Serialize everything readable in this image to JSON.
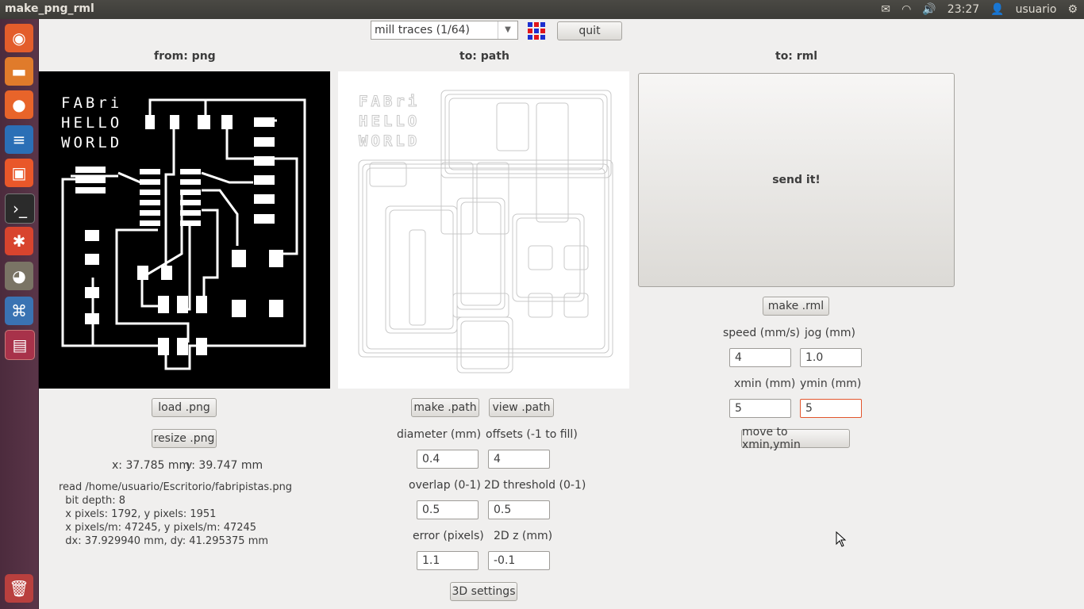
{
  "window": {
    "title": "make_png_rml"
  },
  "tray": {
    "time": "23:27",
    "user": "usuario"
  },
  "toolbar": {
    "mode_select": "mill traces (1/64)",
    "quit_label": "quit"
  },
  "columns": {
    "from_png": "from: png",
    "to_path": "to: path",
    "to_rml": "to: rml"
  },
  "board_text": {
    "line1": "FABri",
    "line2": "HELLO",
    "line3": "WORLD"
  },
  "png_panel": {
    "load_label": "load .png",
    "resize_label": "resize .png",
    "size_readout_x": "x: 37.785 mm",
    "size_readout_y": "y: 39.747 mm",
    "info": "read /home/usuario/Escritorio/fabripistas.png\n  bit depth: 8\n  x pixels: 1792, y pixels: 1951\n  x pixels/m: 47245, y pixels/m: 47245\n  dx: 37.929940 mm, dy: 41.295375 mm"
  },
  "path_panel": {
    "make_path_label": "make .path",
    "view_path_label": "view .path",
    "diameter_label": "diameter (mm)",
    "offsets_label": "offsets (-1 to fill)",
    "diameter_value": "0.4",
    "offsets_value": "4",
    "overlap_label": "overlap (0-1)",
    "threshold_label": "2D threshold (0-1)",
    "overlap_value": "0.5",
    "threshold_value": "0.5",
    "error_label": "error (pixels)",
    "z2d_label": "2D z (mm)",
    "error_value": "1.1",
    "z2d_value": "-0.1",
    "settings3d_label": "3D settings"
  },
  "rml_panel": {
    "send_label": "send it!",
    "make_rml_label": "make .rml",
    "speed_label": "speed (mm/s)",
    "jog_label": "jog (mm)",
    "speed_value": "4",
    "jog_value": "1.0",
    "xmin_label": "xmin (mm)",
    "ymin_label": "ymin (mm)",
    "xmin_value": "5",
    "ymin_value": "5",
    "move_label": "move to xmin,ymin"
  },
  "colors": {
    "accent_focus": "#e2552c",
    "launcher": "#5a3548",
    "topbar": "#3c3b37"
  }
}
